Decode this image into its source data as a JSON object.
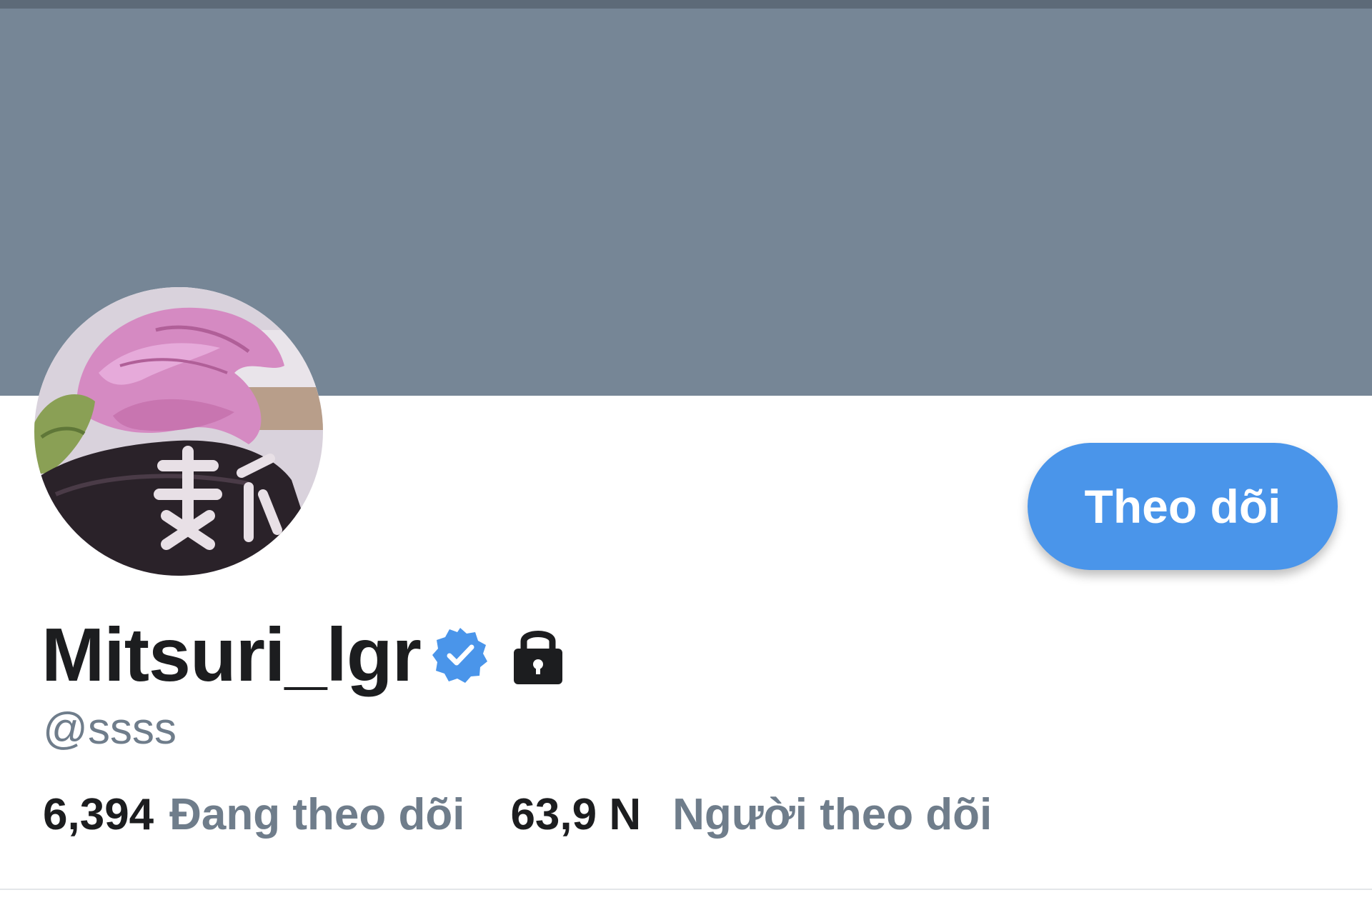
{
  "profile": {
    "display_name": "Mitsuri_lgr",
    "handle": "@ssss",
    "verified_icon": "verified-badge-icon",
    "protected_icon": "lock-icon",
    "avatar_icon": "profile-avatar"
  },
  "actions": {
    "follow_label": "Theo dõi"
  },
  "stats": {
    "following_count": "6,394",
    "following_label": "Đang theo dõi",
    "followers_count": "63,9 N",
    "followers_label": "Người theo dõi"
  },
  "colors": {
    "banner": "#768696",
    "accent": "#4a95ea",
    "text_primary": "#1c1d1f",
    "text_secondary": "#6f7d8b"
  }
}
